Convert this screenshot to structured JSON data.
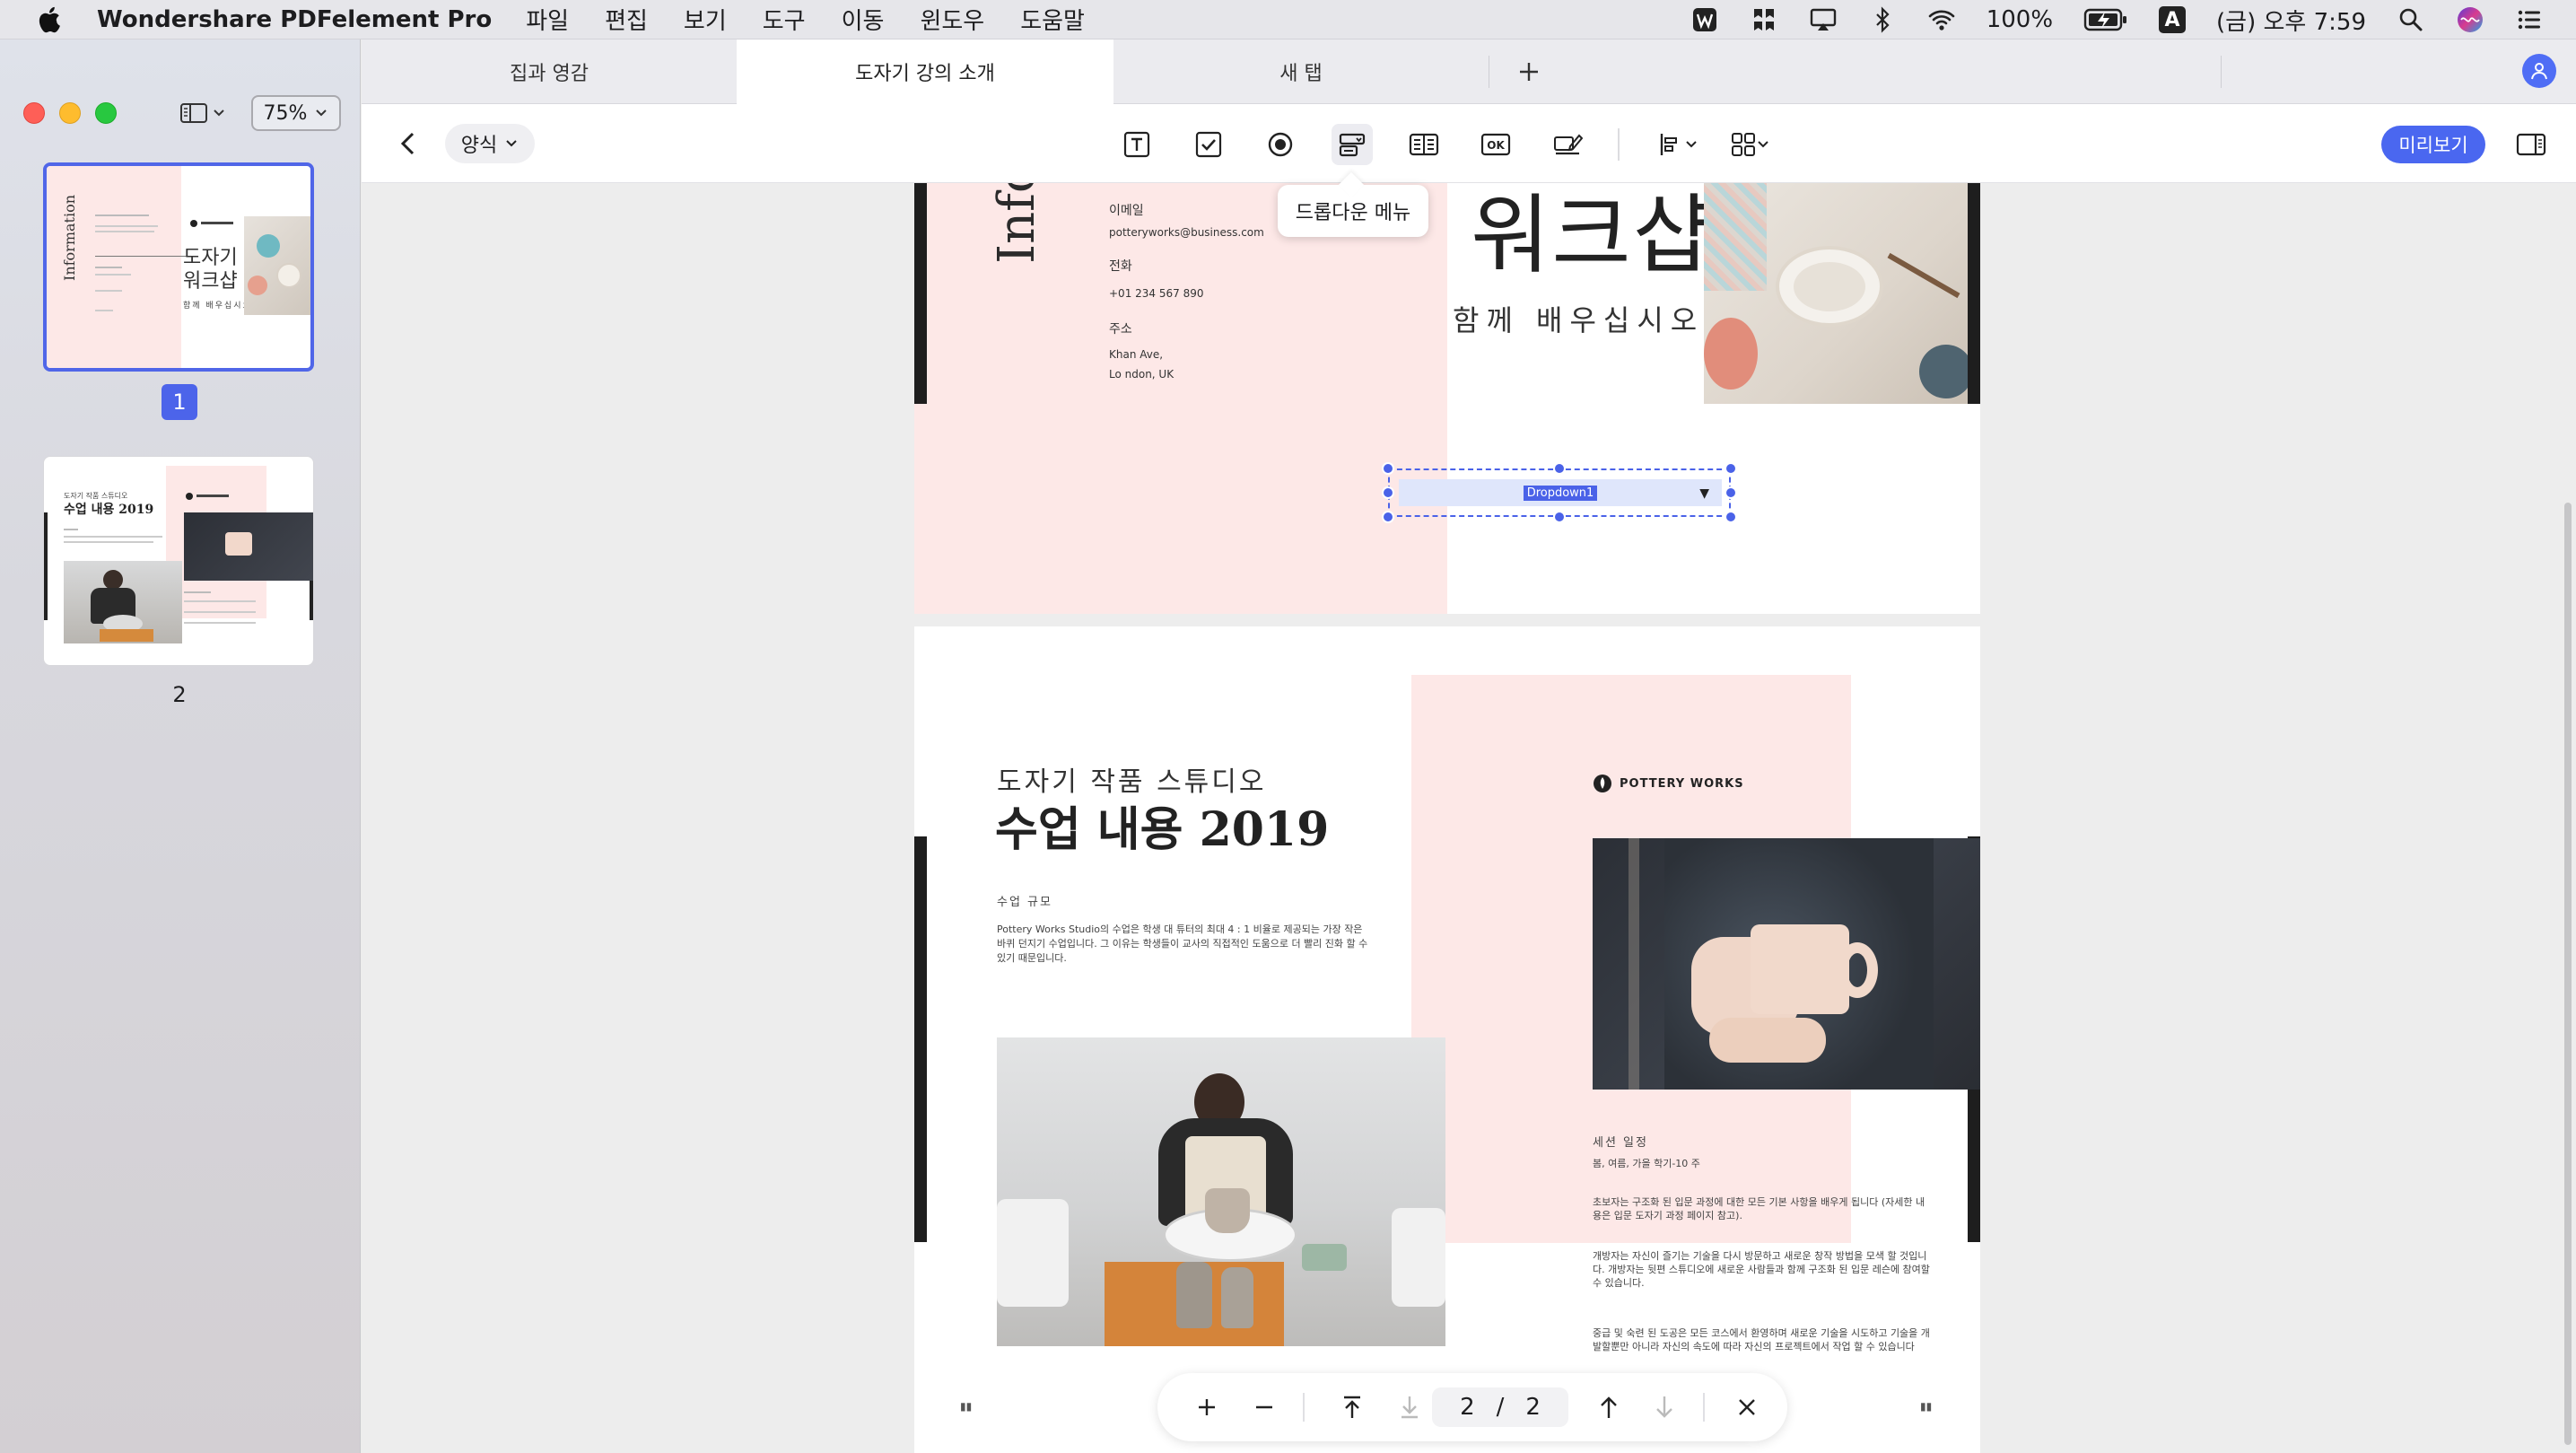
{
  "menubar": {
    "app_name": "Wondershare PDFelement Pro",
    "items": [
      "파일",
      "편집",
      "보기",
      "도구",
      "이동",
      "윈도우",
      "도움말"
    ],
    "battery": "100%",
    "clock": "(금) 오후 7:59",
    "input_source": "A"
  },
  "sidebar": {
    "zoom": "75%",
    "page1_label": "1",
    "page2_label": "2"
  },
  "tabs": [
    {
      "label": "집과 영감"
    },
    {
      "label": "도자기 강의 소개"
    },
    {
      "label": "새 탭"
    }
  ],
  "toolbar": {
    "form_menu": "양식",
    "preview": "미리보기",
    "tooltip": "드롭다운 메뉴"
  },
  "page1": {
    "vertical_heading": "Info",
    "email_label": "이메일",
    "email": "potteryworks@business.com",
    "phone_label": "전화",
    "phone": "+01 234 567 890",
    "address_label": "주소",
    "address_line1": "Khan Ave,",
    "address_line2": "Lo ndon, UK",
    "title": "워크샵",
    "subtitle": "함께 배우십시오"
  },
  "dropdown_field": {
    "name": "Dropdown1"
  },
  "page2": {
    "subtitle": "도자기 작품 스튜디오",
    "title": "수업 내용 2019",
    "section": "수업 규모",
    "paragraph": "Pottery Works Studio의 수업은 학생 대 튜터의 최대 4 : 1 비율로 제공되는 가장 작은 바퀴 던지기 수업입니다. 그 이유는 학생들이 교사의 직접적인 도움으로 더 빨리 진화 할 수 있기 때문입니다.",
    "logo": "POTTERY WORKS",
    "session_label": "세션 일정",
    "seasons": "봄, 여름, 가을 학기-10 주",
    "text1": "초보자는 구조화 된 입문 과정에 대한 모든 기본 사항을 배우게 됩니다 (자세한 내용은 입문 도자기 과정 페이지 참고).",
    "text2": "개방자는 자신이 즐기는 기술을 다시 방문하고 새로운 창작 방법을 모색 할 것입니다. 개방자는 뒷편 스튜디오에 새로운 사람들과 함께 구조화 된 입문 레슨에 참여할 수 있습니다.",
    "text3": "중급 및 숙련 된 도공은 모든 코스에서 환영하며 새로운 기술을 시도하고 기술을 개발할뿐만 아니라 자신의 속도에 따라 자신의 프로젝트에서 작업 할 수 있습니다"
  },
  "page_nav": {
    "current": "2",
    "separator": "/",
    "total": "2"
  },
  "thumbnail1": {
    "vertical": "Information",
    "title": "도자기 워크샵",
    "subtitle": "함께 배우십시오"
  },
  "thumbnail2": {
    "subtitle": "도자기 작품 스튜디오",
    "title": "수업 내용 2019"
  },
  "colors": {
    "accent": "#4a67f0",
    "pink": "#fde8e7",
    "selection": "#4a62e8"
  }
}
